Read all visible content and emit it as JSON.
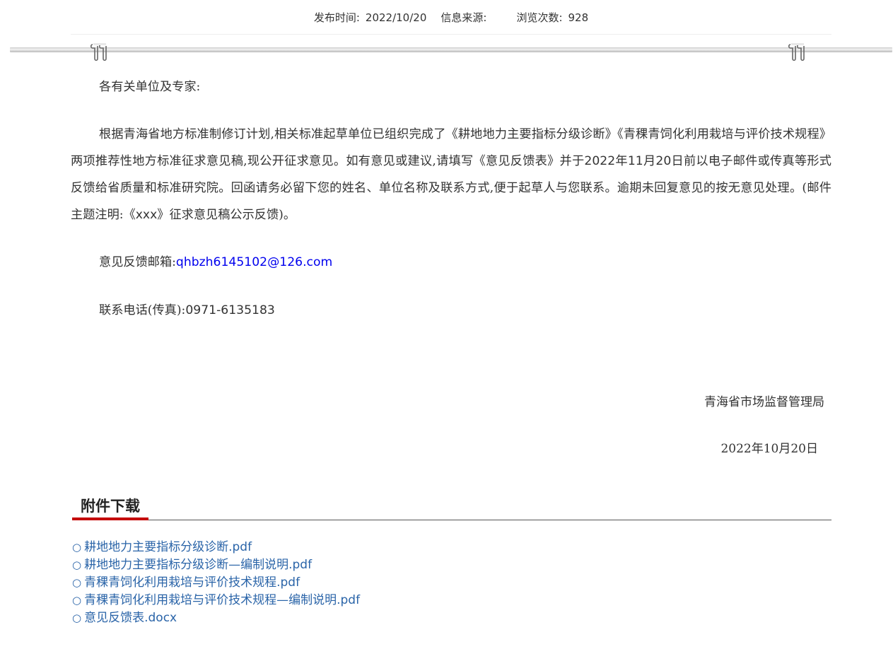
{
  "meta": {
    "publish_label": "发布时间:",
    "publish_date": "2022/10/20",
    "source_label": "信息来源:",
    "views_label": "浏览次数:",
    "views_count": "928"
  },
  "article": {
    "salutation": "各有关单位及专家:",
    "body_part1": "根据青海省地方标准制修订计划,相关标准起草单位已组织完成了《耕地地力主要指标分级诊断》《青稞青饲化利用栽培与评价技术规程》两项推荐性地方标准征求意见稿,现公开征求意见。如有意见或建议,请填写《意见反馈表》并于",
    "deadline_year": "2022",
    "deadline_year_unit": "年",
    "deadline_month": "11",
    "deadline_month_unit": "月",
    "deadline_day": "20",
    "body_part2": "日前以电子邮件或传真等形式反馈给省质量和标准研究院。回函请务必留下您的姓名、单位名称及联系方式,便于起草人与您联系。逾期未回复意见的按无意见处理。(邮件主题注明:《",
    "subject_placeholder": "xxx",
    "body_part3": "》征求意见稿公示反馈)。",
    "email_label": "意见反馈邮箱:",
    "email": "qhbzh6145102@126.com",
    "phone_label": "联系电话(传真):",
    "phone": "0971-6135183",
    "signature": "青海省市场监督管理局",
    "sign_date": "2022年10月20日"
  },
  "attachments": {
    "title": "附件下载",
    "bullet": "○",
    "items": [
      "耕地地力主要指标分级诊断.pdf",
      "耕地地力主要指标分级诊断—编制说明.pdf",
      "青稞青饲化利用栽培与评价技术规程.pdf",
      "青稞青饲化利用栽培与评价技术规程—编制说明.pdf",
      "意见反馈表.docx"
    ]
  },
  "colors": {
    "link": "#2a64a8",
    "email_link": "#0000ee",
    "accent_underline": "#c40000",
    "text": "#333333"
  }
}
